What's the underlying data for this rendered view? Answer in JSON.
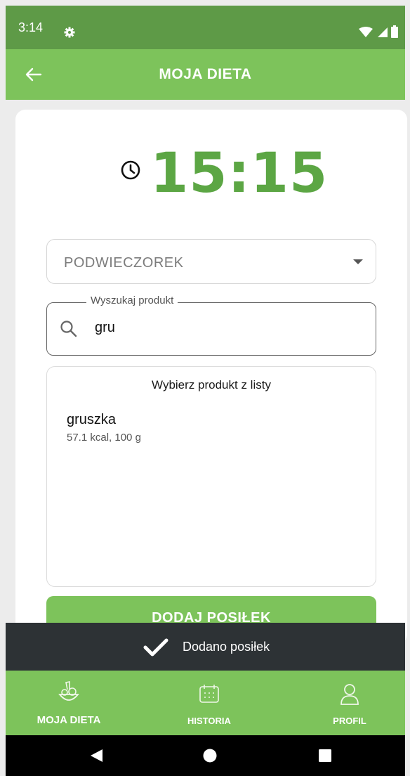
{
  "status_bar": {
    "time": "3:14"
  },
  "app_bar": {
    "title": "MOJA DIETA"
  },
  "meal_time": "15:15",
  "meal_type": {
    "selected": "PODWIECZOREK"
  },
  "search": {
    "label": "Wyszukaj produkt",
    "value": "gru"
  },
  "results": {
    "header": "Wybierz produkt z listy",
    "items": [
      {
        "name": "gruszka",
        "meta": "57.1 kcal, 100 g"
      }
    ]
  },
  "add_button": {
    "label": "DODAJ POSIŁEK"
  },
  "snackbar": {
    "text": "Dodano posiłek"
  },
  "bottom_nav": [
    {
      "label": "MOJA DIETA",
      "icon": "vegetables-icon"
    },
    {
      "label": "HISTORIA",
      "icon": "calendar-icon"
    },
    {
      "label": "PROFIL",
      "icon": "person-icon"
    }
  ],
  "colors": {
    "primary": "#7dc35b",
    "status_bar": "#5e9a47",
    "time_text": "#5ca644",
    "snackbar": "#2d3235"
  }
}
